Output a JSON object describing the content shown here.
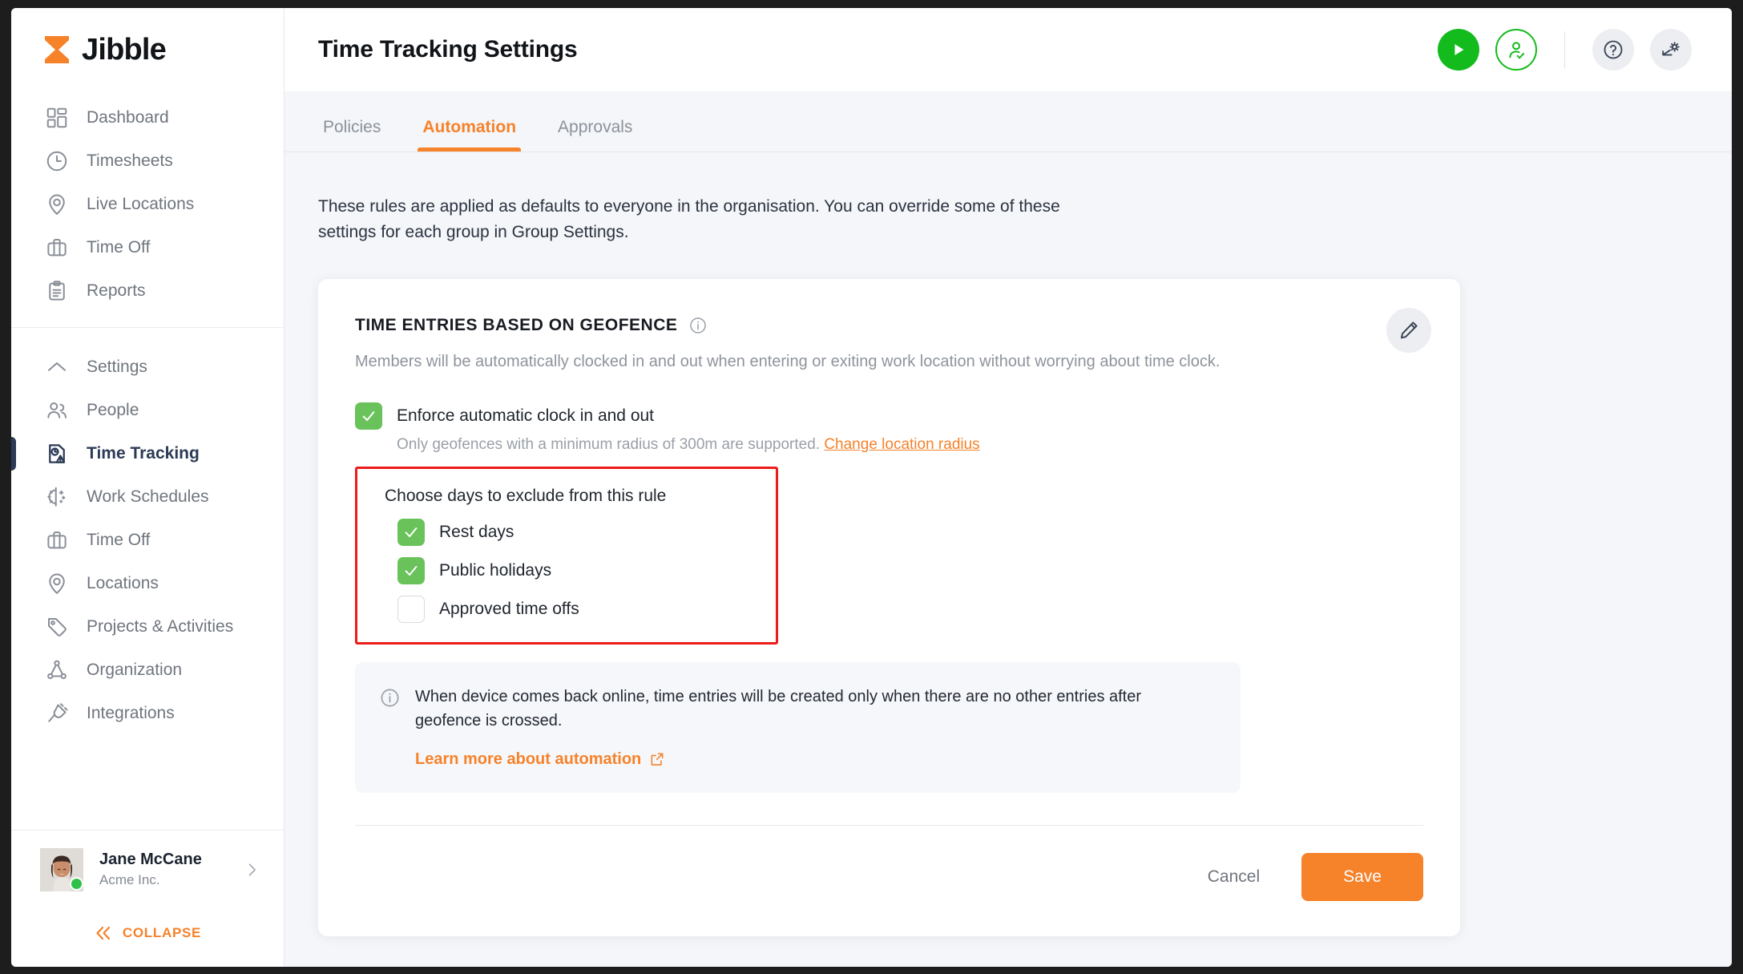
{
  "brand": {
    "name": "Jibble",
    "accent": "#f6822a",
    "logo_icon": "hourglass-icon"
  },
  "sidebar": {
    "groups": [
      {
        "items": [
          {
            "label": "Dashboard",
            "icon": "dashboard-grid-icon",
            "active": false
          },
          {
            "label": "Timesheets",
            "icon": "clock-icon",
            "active": false
          },
          {
            "label": "Live Locations",
            "icon": "map-pin-icon",
            "active": false
          },
          {
            "label": "Time Off",
            "icon": "briefcase-icon",
            "active": false
          },
          {
            "label": "Reports",
            "icon": "clipboard-icon",
            "active": false
          }
        ]
      },
      {
        "items": [
          {
            "label": "Settings",
            "icon": "chevron-up-icon",
            "active": false
          },
          {
            "label": "People",
            "icon": "people-icon",
            "active": false
          },
          {
            "label": "Time Tracking",
            "icon": "time-tracking-icon",
            "active": true
          },
          {
            "label": "Work Schedules",
            "icon": "day-night-icon",
            "active": false
          },
          {
            "label": "Time Off",
            "icon": "briefcase-icon",
            "active": false
          },
          {
            "label": "Locations",
            "icon": "map-pin-icon",
            "active": false
          },
          {
            "label": "Projects & Activities",
            "icon": "tag-icon",
            "active": false
          },
          {
            "label": "Organization",
            "icon": "organization-icon",
            "active": false
          },
          {
            "label": "Integrations",
            "icon": "plug-icon",
            "active": false
          }
        ]
      }
    ],
    "profile": {
      "name": "Jane McCane",
      "org": "Acme Inc.",
      "status": "online"
    },
    "collapse_label": "COLLAPSE"
  },
  "topbar": {
    "title": "Time Tracking Settings",
    "actions": [
      {
        "name": "play-button",
        "icon": "play-icon",
        "color": "#13bb1c"
      },
      {
        "name": "clock-in-person-button",
        "icon": "person-check-icon",
        "color": "#13bb1c"
      },
      {
        "name": "help-button",
        "icon": "question-circle-icon"
      },
      {
        "name": "settings-button",
        "icon": "gear-icon"
      }
    ]
  },
  "tabs": [
    {
      "label": "Policies",
      "active": false
    },
    {
      "label": "Automation",
      "active": true
    },
    {
      "label": "Approvals",
      "active": false
    }
  ],
  "intro": "These rules are applied as defaults to everyone in the organisation. You can override some of these settings for each group in Group Settings.",
  "card": {
    "title": "TIME ENTRIES BASED ON GEOFENCE",
    "description": "Members will be automatically clocked in and out when entering or exiting work location without worrying about time clock.",
    "enforce": {
      "label": "Enforce automatic clock in and out",
      "checked": true,
      "note": "Only geofences with a minimum radius of 300m are supported.",
      "note_link": "Change location radius"
    },
    "exclude": {
      "title": "Choose days to exclude from this rule",
      "highlight_color": "#ee1b1b",
      "options": [
        {
          "label": "Rest days",
          "checked": true
        },
        {
          "label": "Public holidays",
          "checked": true
        },
        {
          "label": "Approved time offs",
          "checked": false
        }
      ]
    },
    "notice": {
      "text": "When device comes back online, time entries will be created only when there are no other entries after geofence is crossed.",
      "link": "Learn more about automation"
    },
    "footer": {
      "cancel": "Cancel",
      "save": "Save"
    }
  }
}
